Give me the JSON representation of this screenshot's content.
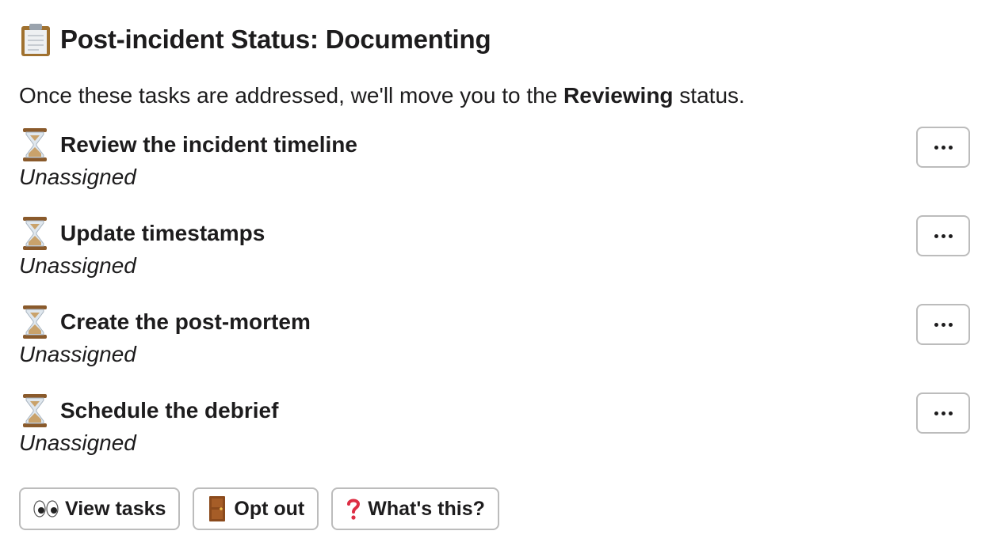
{
  "header": {
    "icon": "clipboard-icon",
    "title": "Post-incident Status: Documenting"
  },
  "intro": {
    "prefix": "Once these tasks are addressed, we'll move you to the ",
    "status": "Reviewing",
    "suffix": " status."
  },
  "tasks": [
    {
      "icon": "hourglass-icon",
      "title": "Review the incident timeline",
      "assignee": "Unassigned"
    },
    {
      "icon": "hourglass-icon",
      "title": "Update timestamps",
      "assignee": "Unassigned"
    },
    {
      "icon": "hourglass-icon",
      "title": "Create the post-mortem",
      "assignee": "Unassigned"
    },
    {
      "icon": "hourglass-icon",
      "title": "Schedule the debrief",
      "assignee": "Unassigned"
    }
  ],
  "more_button_label": "···",
  "actions": [
    {
      "icon": "eyes-icon",
      "label": "View tasks"
    },
    {
      "icon": "door-icon",
      "label": "Opt out"
    },
    {
      "icon": "question-mark-icon",
      "label": "What's this?"
    }
  ],
  "colors": {
    "text": "#1d1c1d",
    "border": "#bcbcbc",
    "question": "#dd2e44"
  }
}
